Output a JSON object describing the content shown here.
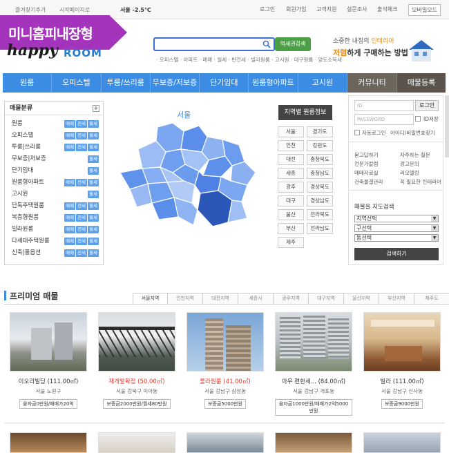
{
  "top": {
    "left": [
      "즐겨찾기추가",
      "시작페이지로"
    ],
    "weather": "서울 -2.5℃",
    "right": [
      "로그인",
      "회원가입",
      "고객지원",
      "설문조사",
      "출석체크"
    ],
    "mobile": "모바일모드"
  },
  "ribbon": "미니홈피내장형",
  "logo": {
    "main": "happy",
    "sub": "ROOM"
  },
  "search": {
    "button": "역세권검색",
    "keywords": "· 오피스텔 · 아파트 · 매매 · 월세 · 반전세 · 빌라원룸 · 고시원 · 대구원룸 · 양도소득세"
  },
  "promo": {
    "line1": "소중한 내집의 ",
    "line1_hl": "인테리어",
    "line2_hl": "저렴",
    "line2": "하게 구매하는 방법"
  },
  "nav": [
    "원룸",
    "오피스텔",
    "투룸/쓰리룸",
    "무보증/저보증",
    "단기임대",
    "원룸형아파트",
    "고시원",
    "커뮤니티",
    "매물등록"
  ],
  "category": {
    "title": "매물분류",
    "items": [
      {
        "name": "원룸",
        "tags": [
          "매매",
          "전세",
          "월세"
        ]
      },
      {
        "name": "오피스텔",
        "tags": [
          "매매",
          "전세",
          "월세"
        ]
      },
      {
        "name": "투룸|쓰리룸",
        "tags": [
          "매매",
          "전세",
          "월세"
        ]
      },
      {
        "name": "무보증|저보증",
        "tags": [
          "월세"
        ]
      },
      {
        "name": "단기임대",
        "tags": [
          "월세"
        ]
      },
      {
        "name": "원룸형아파트",
        "tags": [
          "매매",
          "전세",
          "월세"
        ]
      },
      {
        "name": "고시원",
        "tags": [
          "월세"
        ]
      },
      {
        "name": "단독주택원룸",
        "tags": [
          "매매",
          "전세",
          "월세"
        ]
      },
      {
        "name": "복층형원룸",
        "tags": [
          "매매",
          "전세",
          "월세"
        ]
      },
      {
        "name": "빌라원룸",
        "tags": [
          "매매",
          "전세",
          "월세"
        ]
      },
      {
        "name": "다세대주택원룸",
        "tags": [
          "매매",
          "전세",
          "월세"
        ]
      },
      {
        "name": "신축|풀옵션",
        "tags": [
          "매매",
          "전세",
          "월세"
        ]
      }
    ]
  },
  "map": {
    "title": "서울",
    "region_button": "지역별 원룸정보",
    "regions": [
      "서울",
      "경기도",
      "인천",
      "강원도",
      "대전",
      "충청북도",
      "세종",
      "충청남도",
      "광주",
      "경상북도",
      "대구",
      "경상남도",
      "울산",
      "전라북도",
      "부산",
      "전라남도",
      "제주"
    ]
  },
  "login": {
    "id_placeholder": "ID",
    "pw_placeholder": "PASSWORD",
    "button": "로그인",
    "save_id": "ID저장",
    "auto": "자동로그인",
    "find": "아이디/비밀번호찾기",
    "links": [
      "묻고답하기",
      "자주하는 질문",
      "전문가칼럼",
      "광고문의",
      "매매자료실",
      "리모델링",
      "건축물결관리",
      "꼭 필요한 인테리어"
    ],
    "map_title": "매물을 지도검색",
    "selects": [
      "지역선택",
      "구선택",
      "동선택"
    ],
    "search_button": "검색하기"
  },
  "premium": {
    "title": "프리미엄 매물",
    "tabs": [
      "서울지역",
      "인천지역",
      "대전지역",
      "세종시",
      "광주지역",
      "대구지역",
      "울산지역",
      "부산지역",
      "제주도"
    ],
    "items": [
      {
        "title": "이오리빌딩 (111.00㎡)",
        "addr": "서울 노원구",
        "price": "융자금0만원/매매가20억"
      },
      {
        "title": "재개발확정 (50.00㎡)",
        "addr": "서울 강북구 미아동",
        "price": "보증금2000만원/월세80만원"
      },
      {
        "title": "룰라원룸 (41.00㎡)",
        "addr": "서울 강남구 삼성동",
        "price": "보증금5000만원"
      },
      {
        "title": "아우 편한세... (84.00㎡)",
        "addr": "서울 강남구 개포동",
        "price": "융자금1000만원/매매가2억5000만원"
      },
      {
        "title": "빌라 (111.00㎡)",
        "addr": "서울 강남구 신사동",
        "price": "보증금9000만원"
      }
    ]
  }
}
